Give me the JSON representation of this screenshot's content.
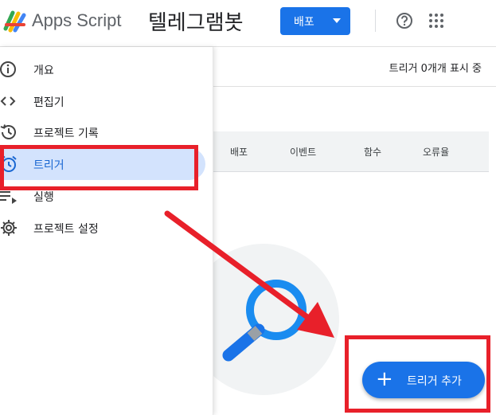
{
  "header": {
    "app_name": "Apps Script",
    "project_title": "텔레그램봇",
    "deploy_label": "배포"
  },
  "sidebar": {
    "items": [
      {
        "label": "개요",
        "icon": "info-icon"
      },
      {
        "label": "편집기",
        "icon": "code-icon"
      },
      {
        "label": "프로젝트 기록",
        "icon": "history-icon"
      },
      {
        "label": "트리거",
        "icon": "alarm-clock-icon",
        "active": true
      },
      {
        "label": "실행",
        "icon": "playlist-play-icon"
      },
      {
        "label": "프로젝트 설정",
        "icon": "gear-icon"
      }
    ]
  },
  "main": {
    "trigger_count": "트리거 0개개 표시 중",
    "columns": [
      "배포",
      "이벤트",
      "함수",
      "오류율"
    ],
    "add_trigger_label": "트리거 추가",
    "add_icon": "+"
  },
  "colors": {
    "accent": "#1a73e8",
    "active_nav_bg": "#d3e3fd",
    "annotation_red": "#e8202a"
  }
}
